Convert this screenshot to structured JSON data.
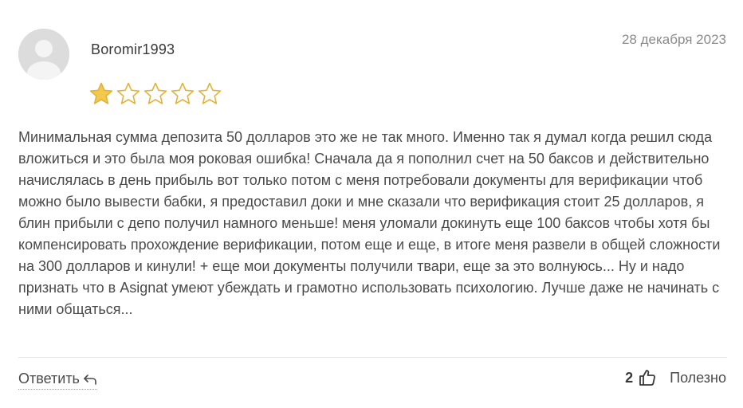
{
  "review": {
    "author": "Boromir1993",
    "date": "28 декабря 2023",
    "rating": 1,
    "max_rating": 5,
    "text": "Минимальная сумма депозита 50 долларов это же не так много. Именно так я думал когда решил сюда вложиться и это была моя роковая ошибка! Сначала да я пополнил счет на 50 баксов и действительно начислялась в день прибыль вот только потом с меня потребовали документы для верификации чтоб можно было вывести бабки, я предоставил доки и мне сказали что верификация стоит 25 долларов, я блин прибыли с депо получил намного меньше! меня уломали докинуть еще 100 баксов чтобы хотя бы компенсировать прохождение верификации, потом еще и еще, в итоге меня развели в общей сложности на 300 долларов и кинули! + еще мои документы получили твари, еще за это волнуюсь... Ну и надо признать что в Asignat умеют убеждать и грамотно использовать психологию. Лучше даже не начинать с ними общаться..."
  },
  "actions": {
    "reply_label": "Ответить",
    "reply_icon": "reply-arrow-icon",
    "like_count": "2",
    "like_icon": "thumbs-up-icon",
    "helpful_label": "Полезно"
  },
  "colors": {
    "star_fill": "#f2c94c",
    "star_stroke": "#e0b43a",
    "text": "#4a4a4a",
    "muted": "#8a8a8a",
    "avatar_bg": "#dcdcdc"
  }
}
